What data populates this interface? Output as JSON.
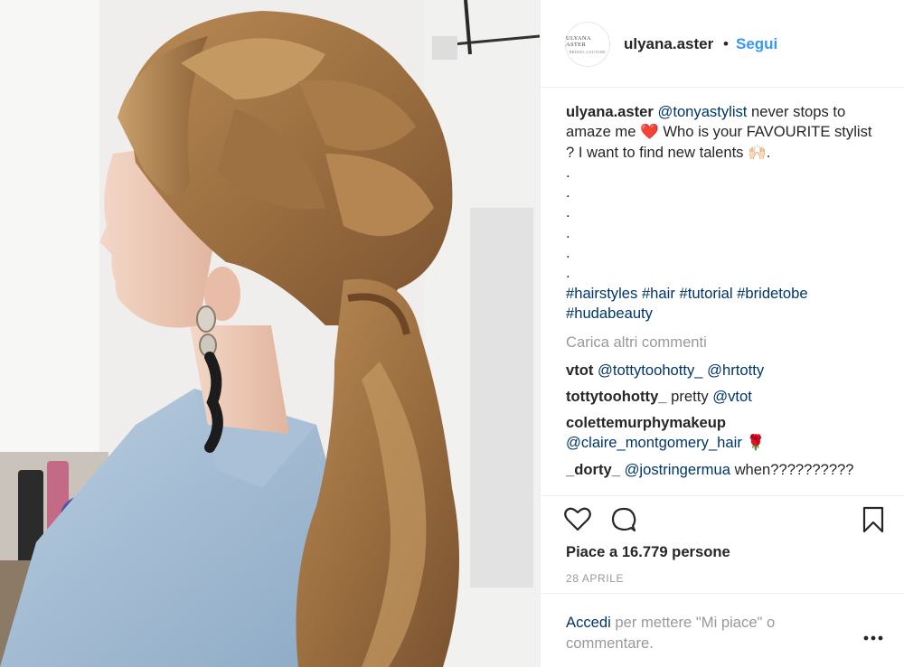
{
  "post": {
    "username": "ulyana.aster",
    "avatar_text": [
      "ULYANA ASTER",
      "BRIDAL COUTURE"
    ],
    "dot": "•",
    "follow_label": "Segui"
  },
  "caption": {
    "username": "ulyana.aster",
    "mention": "@tonyastylist",
    "text_1": " never stops to amaze me ",
    "heart": "❤️",
    "text_2": " Who is your FAVOURITE stylist ? I want to find new talents ",
    "hands": "🙌🏻",
    "text_3": ".",
    "dots": [
      ".",
      ".",
      ".",
      ".",
      ".",
      "."
    ],
    "hashtags": [
      "#hairstyles",
      "#hair",
      "#tutorial",
      "#bridetobe",
      "#hudabeauty"
    ]
  },
  "load_more_label": "Carica altri commenti",
  "comments": [
    {
      "user": "vtot",
      "mentions": [
        "@tottytoohotty_",
        "@hrtotty"
      ],
      "text": "",
      "emoji": ""
    },
    {
      "user": "tottytoohotty_",
      "text_pre": "pretty ",
      "mentions": [
        "@vtot"
      ],
      "text": "",
      "emoji": ""
    },
    {
      "user": "colettemurphymakeup",
      "mentions": [
        "@claire_montgomery_hair"
      ],
      "text": " ",
      "emoji": "🌹"
    },
    {
      "user": "_dorty_",
      "mentions": [
        "@jostringermua"
      ],
      "text": " when??????????",
      "emoji": ""
    }
  ],
  "actions": {
    "like_icon": "heart-outline-icon",
    "comment_icon": "speech-bubble-icon",
    "save_icon": "bookmark-icon",
    "likes_text": "Piace a 16.779 persone",
    "date": "28 APRILE"
  },
  "footer": {
    "login_link": "Accedi",
    "login_text": " per mettere \"Mi piace\" o commentare.",
    "more_icon": "more-options-icon"
  },
  "colors": {
    "link_blue": "#3897f0",
    "mention_blue": "#003569",
    "muted_gray": "#999999",
    "divider": "#efefef"
  }
}
